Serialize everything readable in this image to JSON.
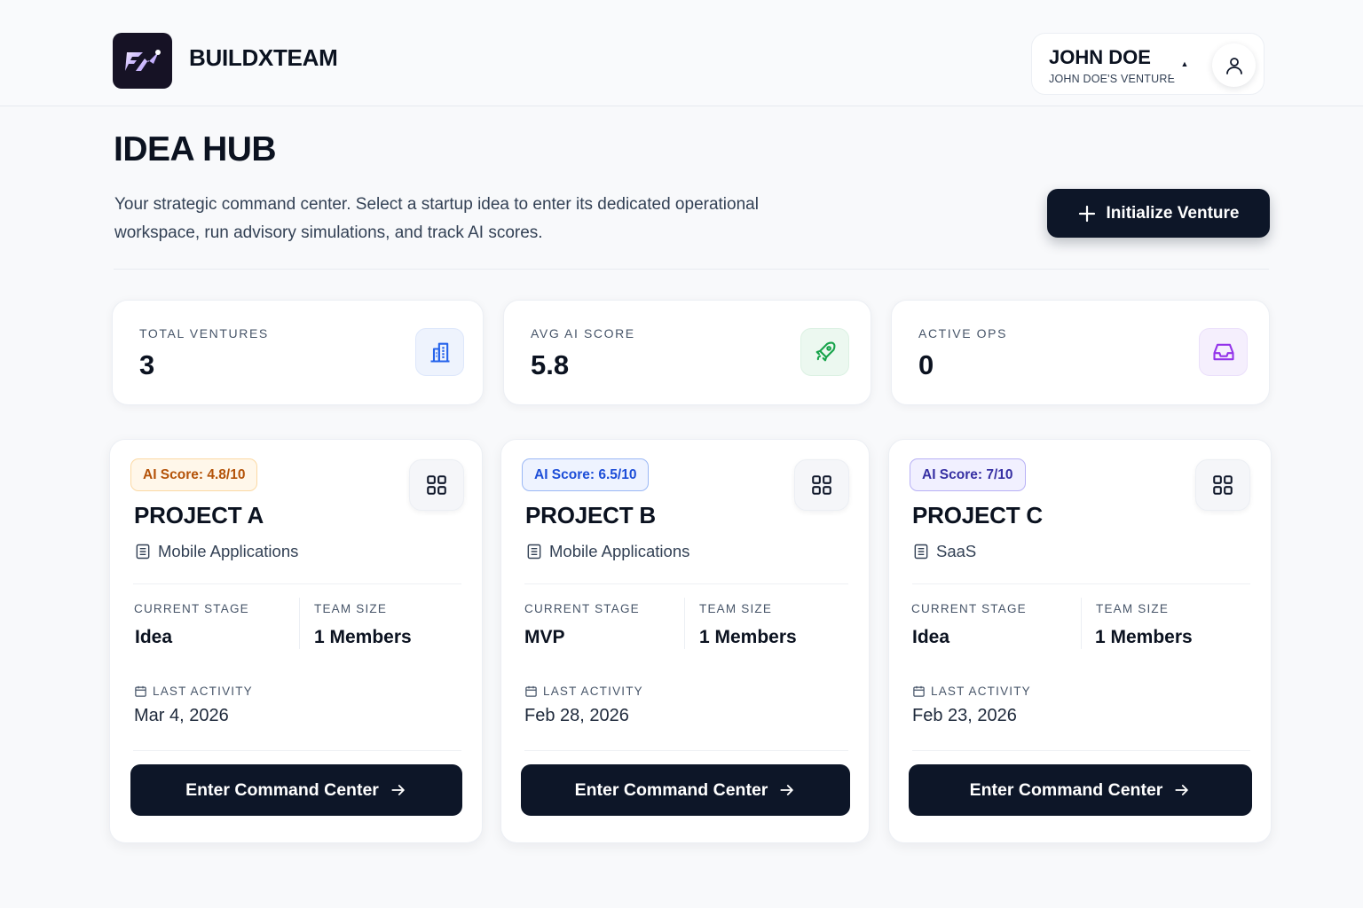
{
  "header": {
    "brand": "BUILDXTEAM",
    "user_name": "JOHN DOE",
    "user_venture": "JOHN DOE'S VENTURE"
  },
  "page": {
    "title": "IDEA HUB",
    "description": "Your strategic command center. Select a startup idea to enter its dedicated operational workspace, run advisory simulations, and track AI scores.",
    "primary_action": "Initialize Venture"
  },
  "stats": [
    {
      "label": "TOTAL VENTURES",
      "value": "3",
      "icon": "building-icon",
      "accent": "#2563eb",
      "accent_bg": "#eef3fd"
    },
    {
      "label": "AVG AI SCORE",
      "value": "5.8",
      "icon": "rocket-icon",
      "accent": "#16a34a",
      "accent_bg": "#ecf8f0"
    },
    {
      "label": "ACTIVE OPS",
      "value": "0",
      "icon": "inbox-icon",
      "accent": "#9333ea",
      "accent_bg": "#f5effd"
    }
  ],
  "projects": [
    {
      "badge": "AI Score: 4.8/10",
      "badge_color": "#b45309",
      "badge_bg": "#fff7ea",
      "badge_border": "#fbd9a4",
      "name": "PROJECT A",
      "category": "Mobile Applications",
      "stage_label": "CURRENT STAGE",
      "stage": "Idea",
      "team_label": "TEAM SIZE",
      "team": "1 Members",
      "activity_label": "LAST ACTIVITY",
      "activity": "Mar 4, 2026",
      "cta": "Enter Command Center"
    },
    {
      "badge": "AI Score: 6.5/10",
      "badge_color": "#1d4ed8",
      "badge_bg": "#eef3ff",
      "badge_border": "#9bb8f5",
      "name": "PROJECT B",
      "category": "Mobile Applications",
      "stage_label": "CURRENT STAGE",
      "stage": "MVP",
      "team_label": "TEAM SIZE",
      "team": "1 Members",
      "activity_label": "LAST ACTIVITY",
      "activity": "Feb 28, 2026",
      "cta": "Enter Command Center"
    },
    {
      "badge": "AI Score: 7/10",
      "badge_color": "#3730a3",
      "badge_bg": "#f1f0ff",
      "badge_border": "#b7b0f5",
      "name": "PROJECT C",
      "category": "SaaS",
      "stage_label": "CURRENT STAGE",
      "stage": "Idea",
      "team_label": "TEAM SIZE",
      "team": "1 Members",
      "activity_label": "LAST ACTIVITY",
      "activity": "Feb 23, 2026",
      "cta": "Enter Command Center"
    }
  ]
}
